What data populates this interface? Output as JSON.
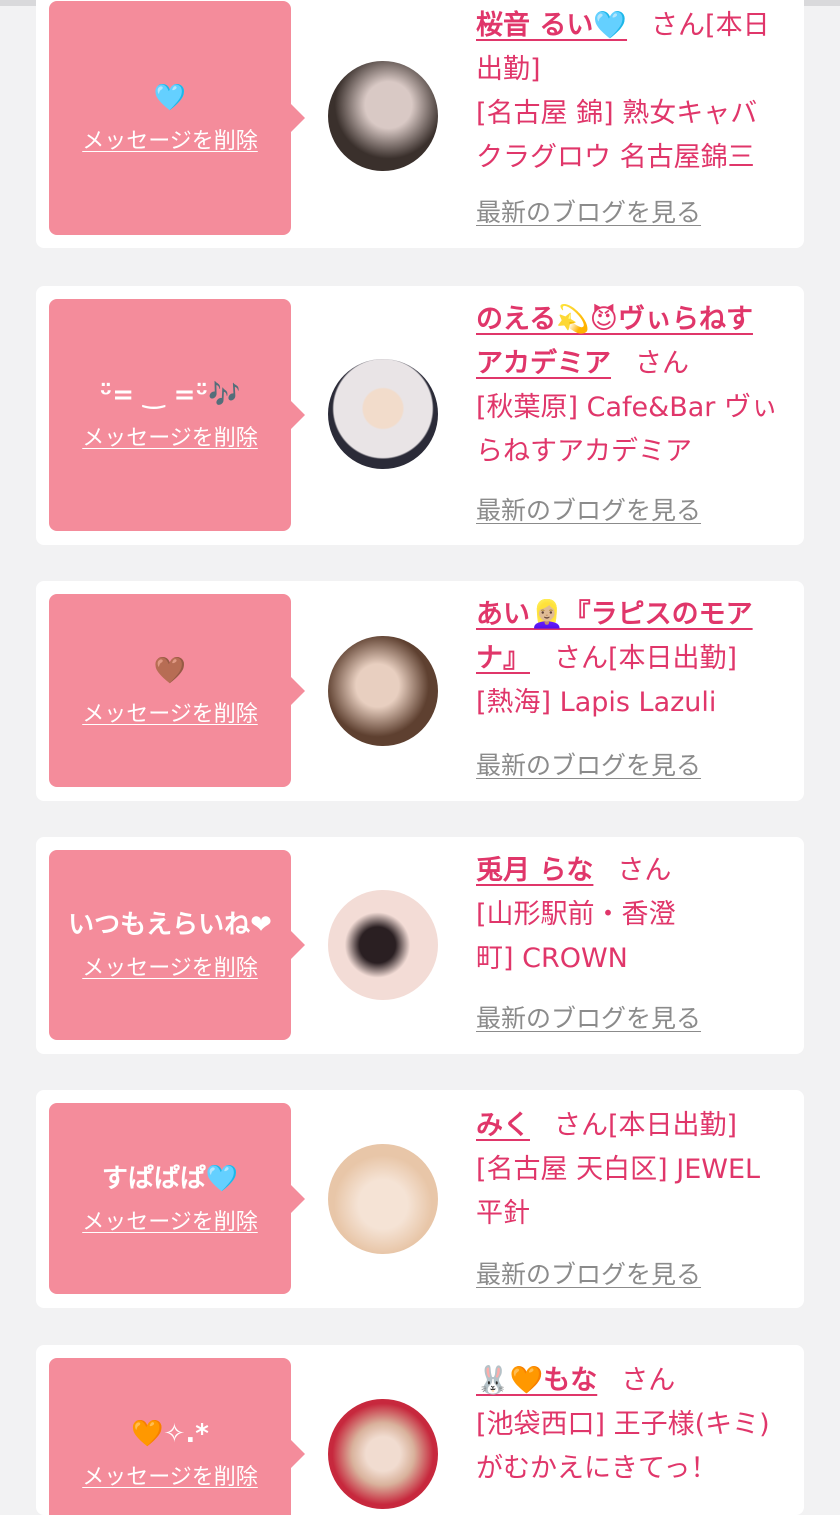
{
  "labels": {
    "delete": "メッセージを削除",
    "blog": "最新のブログを見る",
    "san": "さん"
  },
  "colors": {
    "background": "#f2f2f3",
    "card": "#ffffff",
    "bubble": "#f48c9b",
    "accent": "#e0366a",
    "link_gray": "#8b8b8b"
  },
  "cards": [
    {
      "message": "🩵",
      "name_line1": "桜音 るい🩵",
      "name_line2": "",
      "suffix": "さん[本日",
      "shop_lines": [
        "出勤]",
        "[名古屋 錦] 熟女キャバ",
        "クラグロウ 名古屋錦三"
      ],
      "avatar_colors": [
        "#3a302c",
        "#d9c9c5"
      ]
    },
    {
      "message": "ᵕ̈= ‿ =ᵕ̈🎶",
      "name_line1": "のえる💫😈ヴぃらねす",
      "name_line2": "アカデミア",
      "suffix": "さん",
      "shop_lines": [
        "[秋葉原] Cafe&Bar ヴぃ",
        "らねすアカデミア"
      ],
      "avatar_colors": [
        "#e9e4e6",
        "#2b2b38"
      ]
    },
    {
      "message": "🤎",
      "name_line1": "あい👱🏼‍♀️『ラピスのモア",
      "name_line2": "ナ』",
      "suffix": "さん[本日出勤]",
      "shop_lines": [
        "[熱海] Lapis Lazuli"
      ],
      "avatar_colors": [
        "#5e4030",
        "#e8cfc0"
      ]
    },
    {
      "message": "いつもえらいね❤",
      "name_line1": "兎月 らな",
      "name_line2": "",
      "suffix": "さん",
      "shop_lines": [
        "[山形駅前・香澄",
        "町] CROWN"
      ],
      "avatar_colors": [
        "#f3dcd6",
        "#2a1f22"
      ]
    },
    {
      "message": "すぱぱぱ🩵",
      "name_line1": "みく",
      "name_line2": "",
      "suffix": "さん[本日出勤]",
      "shop_lines": [
        "[名古屋 天白区] JEWEL",
        "平針"
      ],
      "avatar_colors": [
        "#e8c6a8",
        "#f5e3d5"
      ]
    },
    {
      "message": "🧡✧.*",
      "name_line1": "🐰🧡もな",
      "name_line2": "",
      "suffix": "さん",
      "shop_lines": [
        "[池袋西口] 王子様(キミ)",
        "がむかえにきてっ！"
      ],
      "avatar_colors": [
        "#d9b29c",
        "#c7283d"
      ]
    }
  ]
}
